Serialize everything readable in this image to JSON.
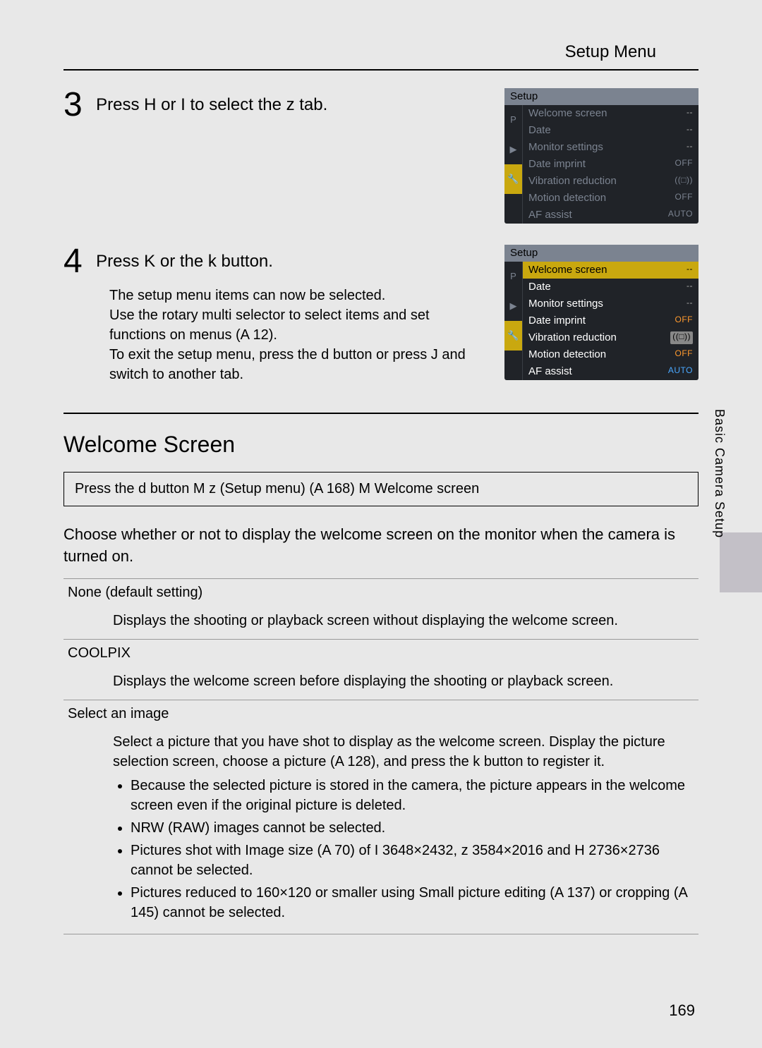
{
  "header": {
    "title": "Setup Menu"
  },
  "steps": [
    {
      "num": "3",
      "head": "Press H  or I   to select the z   tab.",
      "body": [],
      "screen": {
        "title": "Setup",
        "dim": true,
        "rows": [
          {
            "label": "Welcome screen",
            "val": "--"
          },
          {
            "label": "Date",
            "val": "--"
          },
          {
            "label": "Monitor settings",
            "val": "--"
          },
          {
            "label": "Date imprint",
            "val": "OFF"
          },
          {
            "label": "Vibration reduction",
            "val": "((□))"
          },
          {
            "label": "Motion detection",
            "val": "OFF"
          },
          {
            "label": "AF assist",
            "val": "AUTO"
          }
        ]
      }
    },
    {
      "num": "4",
      "head": "Press K  or the k   button.",
      "body": [
        "The setup menu items can now be selected.",
        "Use the rotary multi selector to select items and set functions on menus (A  12).",
        "To exit the setup menu, press the d button or press J and switch to another tab."
      ],
      "screen": {
        "title": "Setup",
        "dim": false,
        "rows": [
          {
            "label": "Welcome screen",
            "val": "--",
            "hl": true
          },
          {
            "label": "Date",
            "val": "--"
          },
          {
            "label": "Monitor settings",
            "val": "--"
          },
          {
            "label": "Date imprint",
            "val": "OFF",
            "cls": "val-off"
          },
          {
            "label": "Vibration reduction",
            "val": "((□))",
            "cls": "val-box"
          },
          {
            "label": "Motion detection",
            "val": "OFF",
            "cls": "val-off"
          },
          {
            "label": "AF assist",
            "val": "AUTO",
            "cls": "val-auto"
          }
        ]
      }
    }
  ],
  "section": {
    "title": "Welcome Screen",
    "breadcrumb": "Press the d     button M  z  (Setup menu) (A  168) M  Welcome screen",
    "intro": "Choose whether or not to display the welcome screen on the monitor when the camera is turned on.",
    "options": [
      {
        "label": "None (default setting)",
        "desc": "Displays the shooting or playback screen without displaying the welcome screen.",
        "bullets": []
      },
      {
        "label": "COOLPIX",
        "desc": "Displays the welcome screen before displaying the shooting or playback screen.",
        "bullets": []
      },
      {
        "label": "Select an image",
        "desc": "Select a picture that you have shot to display as the welcome screen. Display the picture selection screen, choose a picture (A 128), and press the k button to register it.",
        "bullets": [
          "Because the selected picture is stored in the camera, the picture appears in the welcome screen even if the original picture is deleted.",
          "NRW (RAW) images cannot be selected.",
          "Pictures shot with Image size (A  70) of I  3648×2432, z  3584×2016 and H  2736×2736 cannot be selected.",
          "Pictures reduced to 160×120 or smaller using Small picture editing (A  137) or cropping (A  145) cannot be selected."
        ]
      }
    ]
  },
  "side": {
    "label": "Basic Camera Setup"
  },
  "page_number": "169"
}
